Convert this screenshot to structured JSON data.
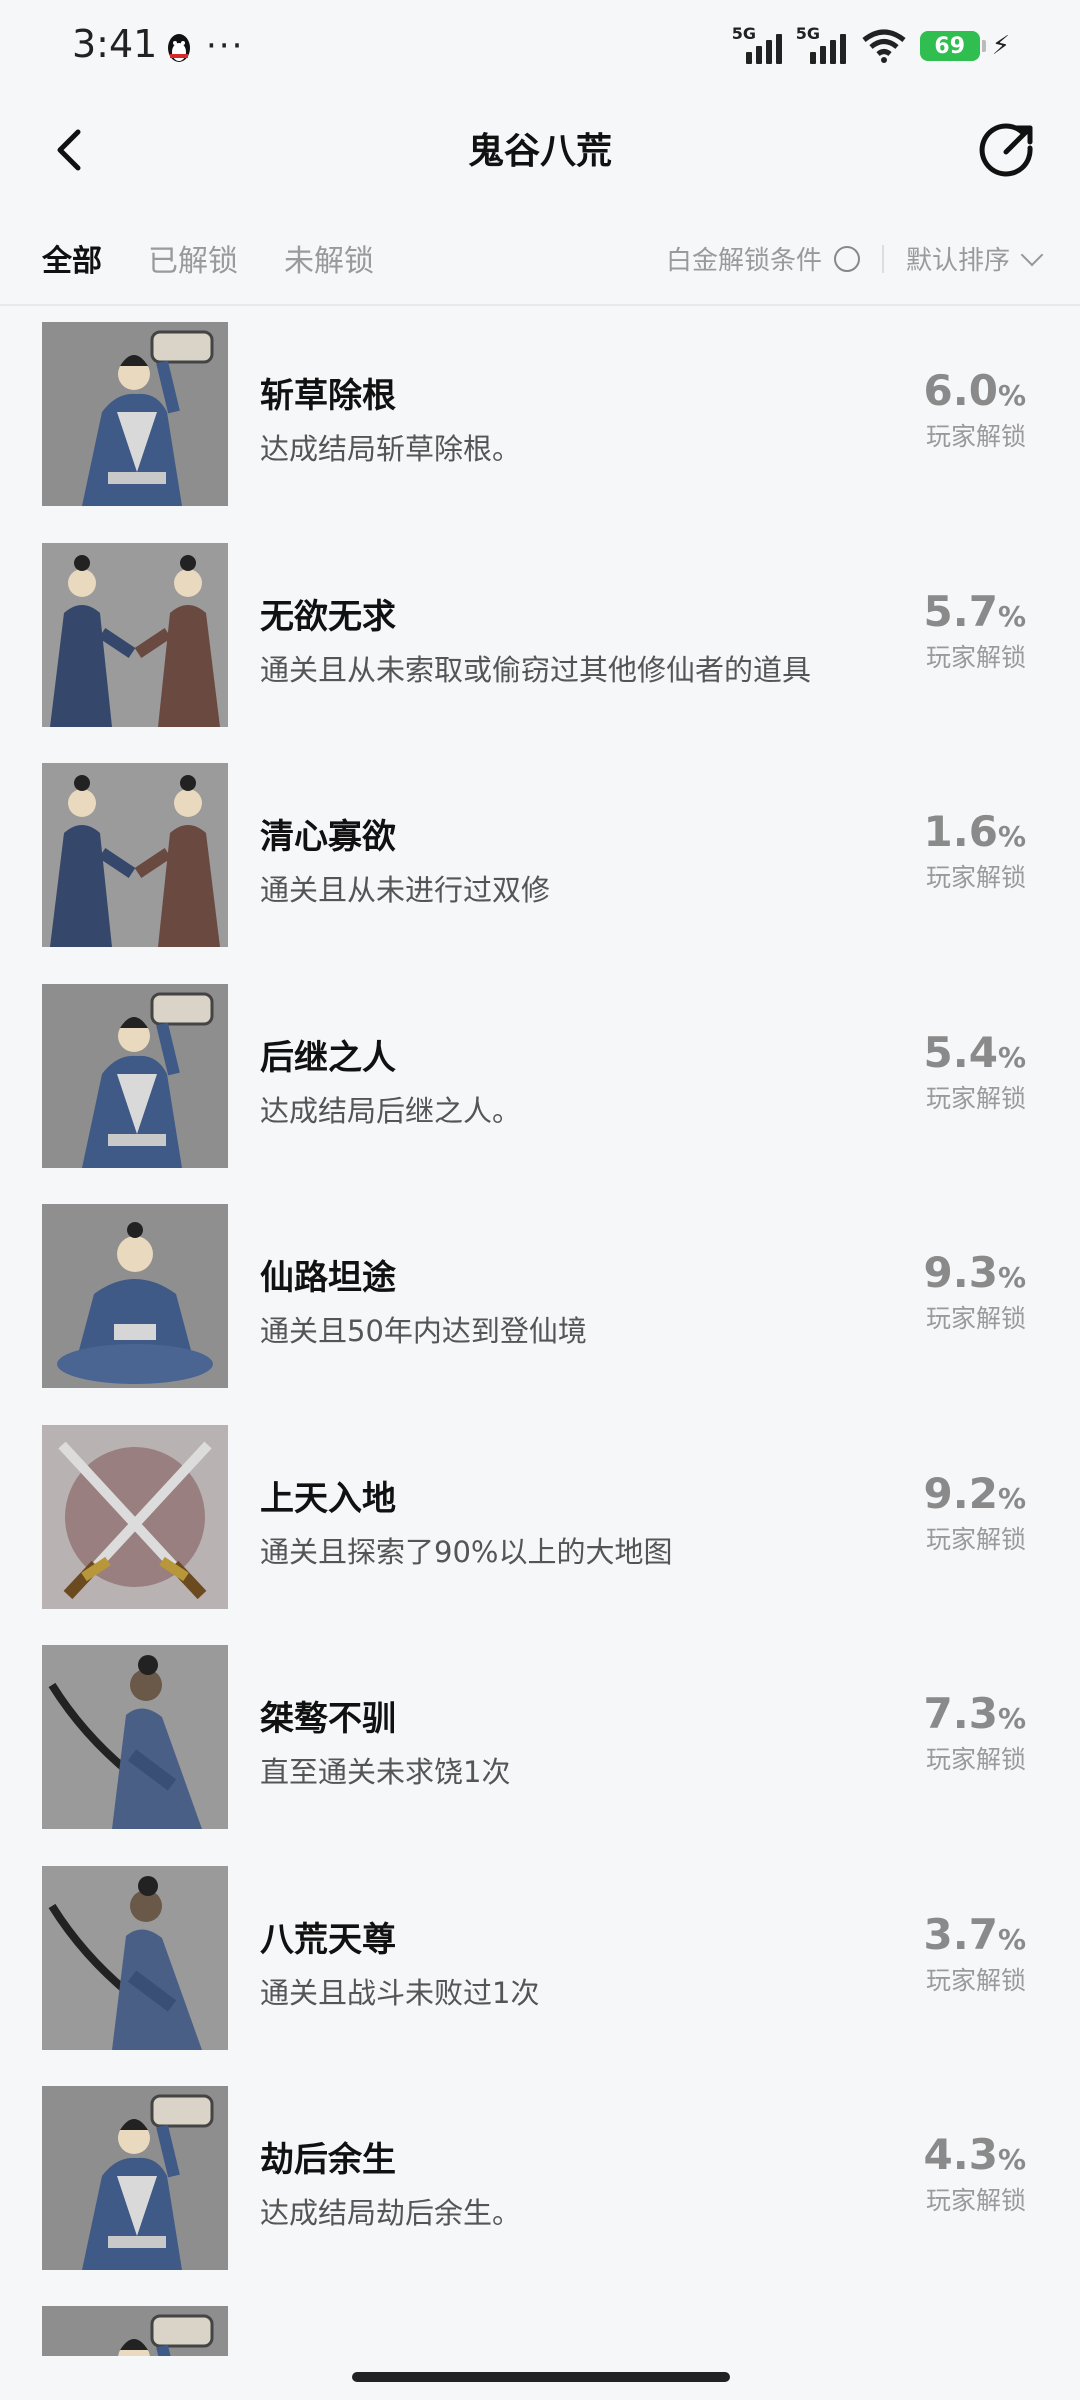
{
  "status_bar": {
    "time": "3:41",
    "more": "···",
    "signal1_label": "5G",
    "signal2_label": "5G",
    "battery": "69",
    "icons": [
      "qq-icon",
      "signal-icon",
      "wifi-icon",
      "battery-icon",
      "charging-icon"
    ]
  },
  "header": {
    "title": "鬼谷八荒",
    "back_icon": "chevron-left-icon",
    "share_icon": "share-icon"
  },
  "filters": {
    "tabs": [
      {
        "label": "全部",
        "active": true
      },
      {
        "label": "已解锁",
        "active": false
      },
      {
        "label": "未解锁",
        "active": false
      }
    ],
    "platinum_label": "白金解锁条件",
    "sort_label": "默认排序"
  },
  "achievements": [
    {
      "title": "斩草除根",
      "desc": "达成结局斩草除根。",
      "pct": "6.0",
      "pct_sign": "%",
      "unlock_label": "玩家解锁",
      "image": "scholar-scroll"
    },
    {
      "title": "无欲无求",
      "desc": "通关且从未索取或偷窃过其他修仙者的道具",
      "pct": "5.7",
      "pct_sign": "%",
      "unlock_label": "玩家解锁",
      "image": "couple"
    },
    {
      "title": "清心寡欲",
      "desc": "通关且从未进行过双修",
      "pct": "1.6",
      "pct_sign": "%",
      "unlock_label": "玩家解锁",
      "image": "couple"
    },
    {
      "title": "后继之人",
      "desc": "达成结局后继之人。",
      "pct": "5.4",
      "pct_sign": "%",
      "unlock_label": "玩家解锁",
      "image": "scholar-scroll"
    },
    {
      "title": "仙路坦途",
      "desc": "通关且50年内达到登仙境",
      "pct": "9.3",
      "pct_sign": "%",
      "unlock_label": "玩家解锁",
      "image": "meditating"
    },
    {
      "title": "上天入地",
      "desc": "通关且探索了90%以上的大地图",
      "pct": "9.2",
      "pct_sign": "%",
      "unlock_label": "玩家解锁",
      "image": "crossed-swords"
    },
    {
      "title": "桀骜不驯",
      "desc": "直至通关未求饶1次",
      "pct": "7.3",
      "pct_sign": "%",
      "unlock_label": "玩家解锁",
      "image": "swordsman"
    },
    {
      "title": "八荒天尊",
      "desc": "通关且战斗未败过1次",
      "pct": "3.7",
      "pct_sign": "%",
      "unlock_label": "玩家解锁",
      "image": "swordsman"
    },
    {
      "title": "劫后余生",
      "desc": "达成结局劫后余生。",
      "pct": "4.3",
      "pct_sign": "%",
      "unlock_label": "玩家解锁",
      "image": "scholar-scroll"
    }
  ]
}
